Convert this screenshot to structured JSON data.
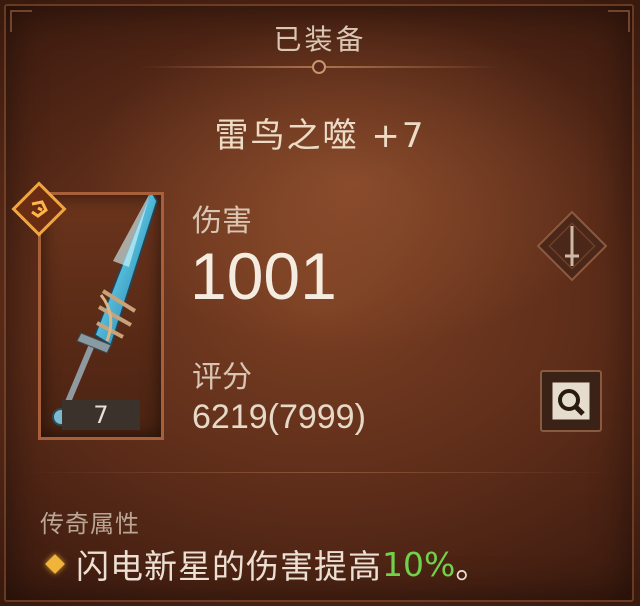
{
  "header": {
    "title": "已装备"
  },
  "item": {
    "name": "雷鸟之噬 +7",
    "slot_count": "7",
    "legendary_icon": "legendary-glyph-icon",
    "weapon_icon": "crystal-dagger-icon"
  },
  "stats": {
    "damage_label": "伤害",
    "damage_value": "1001",
    "score_label": "评分",
    "score_value": "6219(7999)"
  },
  "actions": {
    "compare_icon": "sword-icon",
    "inspect_icon": "magnifier-icon"
  },
  "legendary": {
    "heading": "传奇属性",
    "affix_text": "闪电新星的伤害提高",
    "affix_value": "10%",
    "affix_end": "。"
  },
  "colors": {
    "accent_green": "#6fd24a",
    "bullet_gold": "#f0b43a",
    "background": "#5c2c19"
  }
}
